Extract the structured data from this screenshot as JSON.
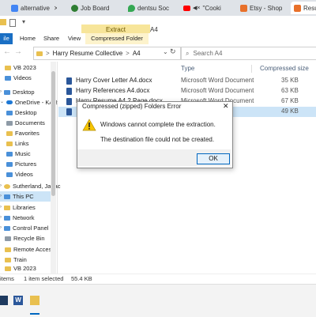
{
  "browser_tabs": [
    {
      "label": "alternative",
      "color": "#4285f4"
    },
    {
      "label": "Job Board",
      "color": "#2e7d32"
    },
    {
      "label": "dentsu Soc",
      "color": "#34a853"
    },
    {
      "label": "\"Cooki",
      "color": "#ff0000"
    },
    {
      "label": "Etsy - Shop",
      "color": "#e8702a"
    },
    {
      "label": "Resu",
      "color": "#e8702a"
    }
  ],
  "window": {
    "context_tab": "Extract",
    "title": "A4"
  },
  "menubar": {
    "file": "ile",
    "home": "Home",
    "share": "Share",
    "view": "View",
    "compressed_tools": "Compressed Folder Tools"
  },
  "address": {
    "path1": "Harry Resume Collective",
    "sep": ">",
    "path2": "A4",
    "search_placeholder": "Search A4"
  },
  "nav": {
    "items": [
      {
        "label": "VB 2023"
      },
      {
        "label": "Videos"
      },
      {
        "label": "Desktop"
      },
      {
        "label": "OneDrive - KAR"
      },
      {
        "label": "Desktop"
      },
      {
        "label": "Documents"
      },
      {
        "label": "Favorites"
      },
      {
        "label": "Links"
      },
      {
        "label": "Music"
      },
      {
        "label": "Pictures"
      },
      {
        "label": "Videos"
      },
      {
        "label": "Sutherland, Jariac"
      },
      {
        "label": "This PC"
      },
      {
        "label": "Libraries"
      },
      {
        "label": "Network"
      },
      {
        "label": "Control Panel"
      },
      {
        "label": "Recycle Bin"
      },
      {
        "label": "Remote Access"
      },
      {
        "label": "Train"
      },
      {
        "label": "VB 2023"
      }
    ]
  },
  "columns": {
    "type": "Type",
    "size": "Compressed size"
  },
  "files": [
    {
      "name": "Harry Cover Letter A4.docx",
      "type": "Microsoft Word Document",
      "size": "35 KB"
    },
    {
      "name": "Harry References A4.docx",
      "type": "Microsoft Word Document",
      "size": "63 KB"
    },
    {
      "name": "Harry Resume A4 2 Page.docx",
      "type": "Microsoft Word Document",
      "size": "67 KB"
    },
    {
      "name": "",
      "type": "zipped)",
      "size": "49 KB"
    }
  ],
  "status": {
    "items": "items",
    "selected": "1 item selected",
    "size": "55.4 KB"
  },
  "dialog": {
    "title": "Compressed (zipped) Folders Error",
    "message1": "Windows cannot complete the extraction.",
    "message2": "The destination file could not be created.",
    "ok": "OK",
    "close": "✕"
  }
}
